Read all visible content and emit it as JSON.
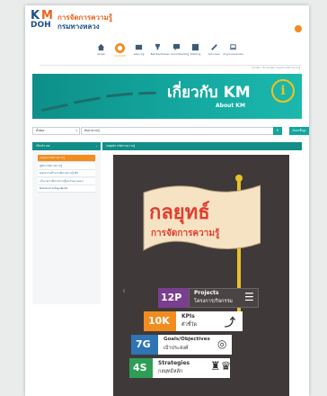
{
  "header": {
    "logo_top": "KM",
    "logo_bottom": "DOH",
    "brand_line1": "การจัดการความรู้",
    "brand_line2": "กรมทางหลวง"
  },
  "nav": {
    "items": [
      {
        "label": "หน้าหลัก",
        "icon": "home-icon"
      },
      {
        "label": "เกี่ยวกับ KM",
        "icon": "info-icon",
        "active": true
      },
      {
        "label": "คลังความรู้",
        "icon": "book-icon"
      },
      {
        "label": "Best Practice",
        "icon": "trophy-icon"
      },
      {
        "label": "บทความแลกเปลี่ยนเรียนรู้",
        "icon": "chat-icon"
      },
      {
        "label": "E-Sharing",
        "icon": "share-icon"
      },
      {
        "label": "ลิงก์ภายนอก",
        "icon": "link-icon"
      },
      {
        "label": "เข้าสู่ระบบ/ลงทะเบียน",
        "icon": "laptop-icon"
      }
    ],
    "breadcrumb": "หน้าหลัก / เกี่ยวกับ KM / กลยุทธ์การจัดการความรู้"
  },
  "banner": {
    "title": "เกี่ยวกับ KM",
    "subtitle": "About KM"
  },
  "search": {
    "scope_value": "ทั้งหมด",
    "query_value": "ค้นหาความรู้",
    "search_icon": "search-icon",
    "advanced_label": "ค้นหาขั้นสูง"
  },
  "sidebar": {
    "title": "เกี่ยวกับ KM",
    "items": [
      {
        "label": "กลยุทธ์การจัดการความรู้",
        "active": true
      },
      {
        "label": "คู่มือการจัดการความรู้"
      },
      {
        "label": "คณะทำงานด้านการจัดการความรู้ KM"
      },
      {
        "label": "นโยบายการจัดการความรู้ของกรมทางหลวง"
      },
      {
        "label": "ติดต่อสอบถามข้อมูลเพิ่มเติม"
      }
    ]
  },
  "content": {
    "title": "กลยุทธ์การจัดการความรู้",
    "poster": {
      "flag_line1": "กลยุทธ์",
      "flag_line2": "การจัดการความรู้",
      "rows": [
        {
          "code": "12P",
          "en": "Projects",
          "th": "โครงการ/กิจกรรม",
          "color": "#7a3e8e",
          "icon": "checklist-icon"
        },
        {
          "code": "10K",
          "en": "KPIs",
          "th": "ตัวชี้วัด",
          "color": "#f28c1e",
          "icon": "chart-icon"
        },
        {
          "code": "7G",
          "en": "Goals/Objectives",
          "th": "เป้าประสงค์",
          "color": "#2f74b5",
          "icon": "target-icon"
        },
        {
          "code": "4S",
          "en": "Strategies",
          "th": "กลยุทธ์หลัก",
          "color": "#2e9e57",
          "icon": "chess-icon"
        }
      ]
    }
  }
}
